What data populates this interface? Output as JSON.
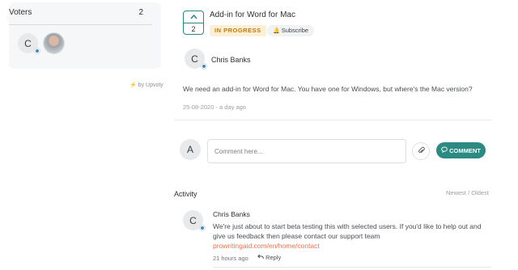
{
  "voters": {
    "title": "Voters",
    "count": "2",
    "items": [
      {
        "initial": "C",
        "type": "initial"
      },
      {
        "type": "photo"
      }
    ]
  },
  "powered_by": "by Upvoty",
  "post": {
    "upvote_count": "2",
    "title": "Add-in for Word for Mac",
    "status": "IN PROGRESS",
    "subscribe_label": "Subscribe",
    "author_initial": "C",
    "author_name": "Chris Banks",
    "body": "We need an add-in for Word for Mac. You have one for Windows, but where's the Mac version?",
    "date": "25-08-2020 - a day ago"
  },
  "composer": {
    "avatar_initial": "A",
    "placeholder": "Comment here...",
    "submit_label": "COMMENT"
  },
  "activity": {
    "title": "Activity",
    "sort_label": "Newest / Oldest",
    "comments": [
      {
        "initial": "C",
        "author": "Chris Banks",
        "text": "We're just about to start beta testing this with selected users. If you'd like to help out and give us feedback then please contact our support team",
        "link": "prowritingaid.com/en/home/contact",
        "time": "21 hours ago",
        "reply_label": "Reply"
      }
    ]
  },
  "colors": {
    "accent": "#2b8a82",
    "status_bg": "#fbefd6",
    "status_text": "#c07a11",
    "link": "#e8734d"
  }
}
